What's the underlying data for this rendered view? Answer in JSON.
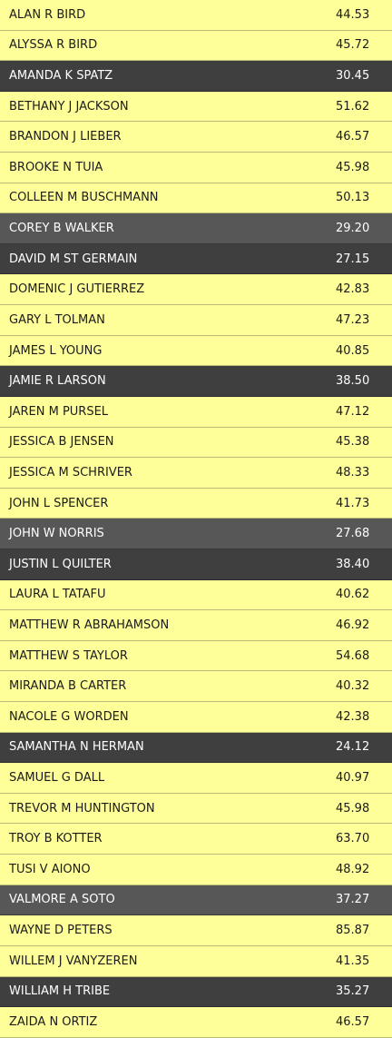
{
  "rows": [
    {
      "name": "ALAN R BIRD",
      "value": "44.53",
      "shade": "light"
    },
    {
      "name": "ALYSSA R BIRD",
      "value": "45.72",
      "shade": "light"
    },
    {
      "name": "AMANDA K SPATZ",
      "value": "30.45",
      "shade": "dark"
    },
    {
      "name": "BETHANY J JACKSON",
      "value": "51.62",
      "shade": "light"
    },
    {
      "name": "BRANDON J LIEBER",
      "value": "46.57",
      "shade": "light"
    },
    {
      "name": "BROOKE N TUIA",
      "value": "45.98",
      "shade": "light"
    },
    {
      "name": "COLLEEN M BUSCHMANN",
      "value": "50.13",
      "shade": "light"
    },
    {
      "name": "COREY B WALKER",
      "value": "29.20",
      "shade": "mid"
    },
    {
      "name": "DAVID M ST GERMAIN",
      "value": "27.15",
      "shade": "dark"
    },
    {
      "name": "DOMENIC J GUTIERREZ",
      "value": "42.83",
      "shade": "light"
    },
    {
      "name": "GARY L TOLMAN",
      "value": "47.23",
      "shade": "light"
    },
    {
      "name": "JAMES L YOUNG",
      "value": "40.85",
      "shade": "light"
    },
    {
      "name": "JAMIE R LARSON",
      "value": "38.50",
      "shade": "dark"
    },
    {
      "name": "JAREN M PURSEL",
      "value": "47.12",
      "shade": "light"
    },
    {
      "name": "JESSICA B JENSEN",
      "value": "45.38",
      "shade": "light"
    },
    {
      "name": "JESSICA M SCHRIVER",
      "value": "48.33",
      "shade": "light"
    },
    {
      "name": "JOHN L SPENCER",
      "value": "41.73",
      "shade": "light"
    },
    {
      "name": "JOHN W NORRIS",
      "value": "27.68",
      "shade": "mid"
    },
    {
      "name": "JUSTIN L QUILTER",
      "value": "38.40",
      "shade": "dark"
    },
    {
      "name": "LAURA L TATAFU",
      "value": "40.62",
      "shade": "light"
    },
    {
      "name": "MATTHEW R ABRAHAMSON",
      "value": "46.92",
      "shade": "light"
    },
    {
      "name": "MATTHEW S TAYLOR",
      "value": "54.68",
      "shade": "light"
    },
    {
      "name": "MIRANDA B CARTER",
      "value": "40.32",
      "shade": "light"
    },
    {
      "name": "NACOLE G WORDEN",
      "value": "42.38",
      "shade": "light"
    },
    {
      "name": "SAMANTHA N HERMAN",
      "value": "24.12",
      "shade": "dark"
    },
    {
      "name": "SAMUEL G DALL",
      "value": "40.97",
      "shade": "light"
    },
    {
      "name": "TREVOR M HUNTINGTON",
      "value": "45.98",
      "shade": "light"
    },
    {
      "name": "TROY B KOTTER",
      "value": "63.70",
      "shade": "light"
    },
    {
      "name": "TUSI V AIONO",
      "value": "48.92",
      "shade": "light"
    },
    {
      "name": "VALMORE A SOTO",
      "value": "37.27",
      "shade": "mid"
    },
    {
      "name": "WAYNE D PETERS",
      "value": "85.87",
      "shade": "light"
    },
    {
      "name": "WILLEM J VANYZEREN",
      "value": "41.35",
      "shade": "light"
    },
    {
      "name": "WILLIAM H TRIBE",
      "value": "35.27",
      "shade": "dark"
    },
    {
      "name": "ZAIDA N ORTIZ",
      "value": "46.57",
      "shade": "light"
    }
  ]
}
